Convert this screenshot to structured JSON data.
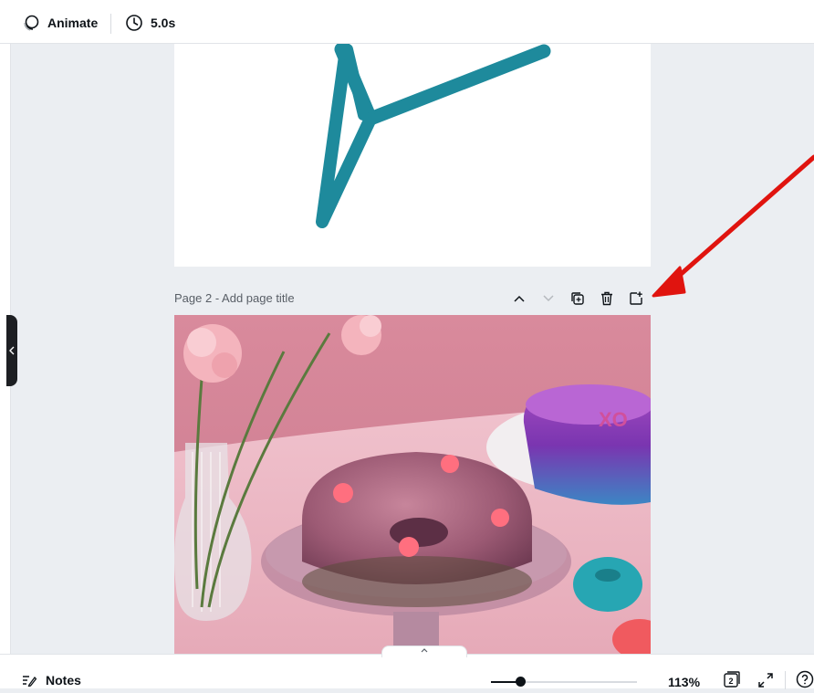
{
  "toolbar": {
    "animate_label": "Animate",
    "duration_label": "5.0s"
  },
  "page2": {
    "title": "Page 2 - Add page title",
    "actions": [
      "move-page-up",
      "move-page-down",
      "duplicate-page",
      "delete-page",
      "add-page"
    ]
  },
  "photo": {
    "jelly_text": "XO"
  },
  "bottombar": {
    "notes_label": "Notes",
    "zoom_label": "113%",
    "zoom_level_percent": 113,
    "page_count": "2"
  },
  "colors": {
    "canvas_bg": "#ebeef2",
    "star_teal": "#1e8a9c",
    "annotation_arrow": "#e0140f",
    "photo_backdrop": "#d9889b"
  }
}
